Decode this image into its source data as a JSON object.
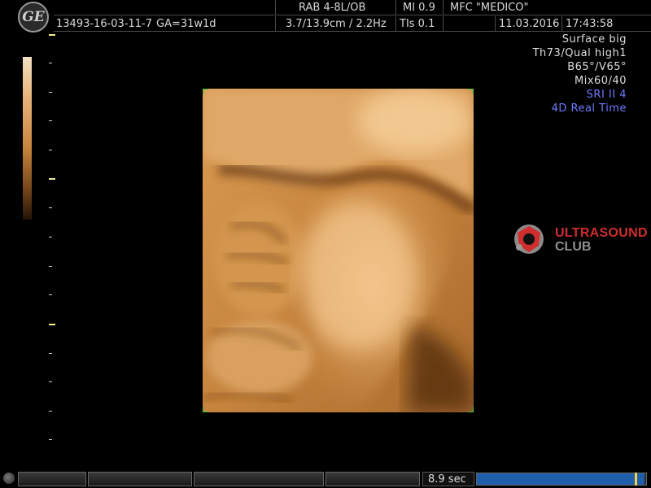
{
  "header": {
    "logo_text": "GE",
    "patient_id": "13493-16-03-11-7",
    "ga": "GA=31w1d",
    "probe": "RAB 4-8L/OB",
    "depth_freq": "3.7/13.9cm / 2.2Hz",
    "mi": "MI  0.9",
    "tis": "TIs  0.1",
    "institution": "MFC \"MEDICO\"",
    "date": "11.03.2016",
    "time": "17:43:58"
  },
  "params": {
    "render_mode": "Surface big",
    "threshold_quality": "Th73/Qual high1",
    "angles": "B65°/V65°",
    "mix": "Mix60/40",
    "sri": "SRI II 4",
    "mode": "4D Real Time"
  },
  "watermark": {
    "line1": "ULTRASOUND",
    "line2": "CLUB"
  },
  "footer": {
    "cine_time": "8.9 sec",
    "cine_progress": 0.99
  },
  "colors": {
    "scan_tone": "#c98640",
    "params_blue": "#6f7bff",
    "brand_red": "#d02d2d",
    "cine_blue": "#1f5eaa"
  }
}
